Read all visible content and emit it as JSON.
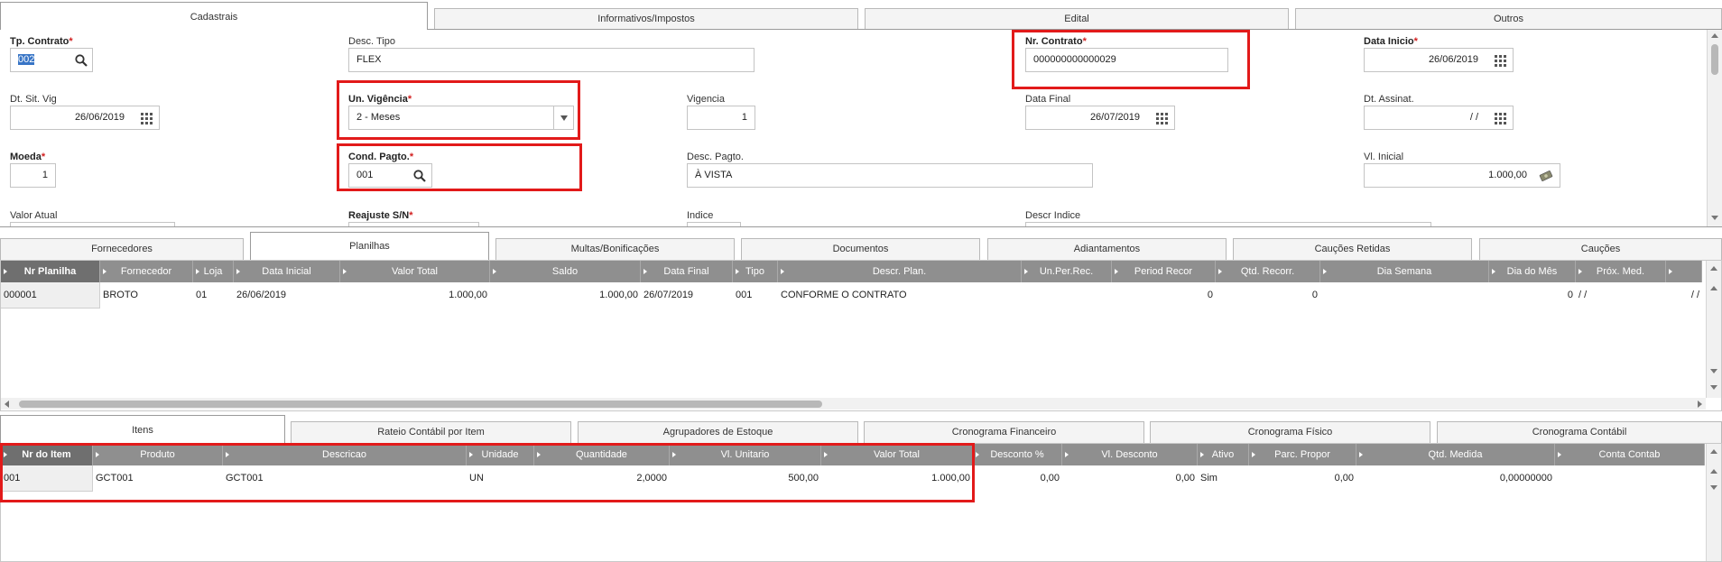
{
  "top_tabs": [
    "Cadastrais",
    "Informativos/Impostos",
    "Edital",
    "Outros"
  ],
  "form": {
    "tp_contrato": {
      "label": "Tp. Contrato",
      "value": "002"
    },
    "desc_tipo": {
      "label": "Desc. Tipo",
      "value": "FLEX"
    },
    "nr_contrato": {
      "label": "Nr. Contrato",
      "value": "000000000000029"
    },
    "data_inicio": {
      "label": "Data Inicio",
      "value": "26/06/2019"
    },
    "dt_sit_vig": {
      "label": "Dt. Sit. Vig",
      "value": "26/06/2019"
    },
    "un_vigencia": {
      "label": "Un. Vigência",
      "value": "2 - Meses"
    },
    "vigencia": {
      "label": "Vigencia",
      "value": "1"
    },
    "data_final": {
      "label": "Data Final",
      "value": "26/07/2019"
    },
    "dt_assinat": {
      "label": "Dt. Assinat.",
      "value": "/  /"
    },
    "moeda": {
      "label": "Moeda",
      "value": "1"
    },
    "cond_pagto": {
      "label": "Cond. Pagto.",
      "value": "001"
    },
    "desc_pagto": {
      "label": "Desc. Pagto.",
      "value": "À VISTA"
    },
    "vl_inicial": {
      "label": "Vl. Inicial",
      "value": "1.000,00"
    },
    "valor_atual": {
      "label": "Valor Atual"
    },
    "reajuste": {
      "label": "Reajuste S/N"
    },
    "indice": {
      "label": "Indice"
    },
    "descr_indice": {
      "label": "Descr Indice"
    },
    "required_mark": "*"
  },
  "middle_tabs": [
    "Fornecedores",
    "Planilhas",
    "Multas/Bonificações",
    "Documentos",
    "Adiantamentos",
    "Cauções Retidas",
    "Cauções"
  ],
  "planilhas": {
    "headers": [
      "Nr Planilha",
      "Fornecedor",
      "Loja",
      "Data Inicial",
      "Valor Total",
      "Saldo",
      "Data Final",
      "Tipo",
      "Descr. Plan.",
      "Un.Per.Rec.",
      "Period Recor",
      "Qtd. Recorr.",
      "Dia Semana",
      "Dia do Mês",
      "Próx. Med.",
      ""
    ],
    "rows": [
      [
        "000001",
        "BROTO",
        "01",
        "26/06/2019",
        "1.000,00",
        "1.000,00",
        "26/07/2019",
        "001",
        "CONFORME O CONTRATO",
        "",
        "0",
        "0",
        "",
        "0",
        "/  /",
        "/  /"
      ]
    ]
  },
  "bottom_tabs": [
    "Itens",
    "Rateio Contábil por Item",
    "Agrupadores de Estoque",
    "Cronograma Financeiro",
    "Cronograma Físico",
    "Cronograma Contábil"
  ],
  "itens": {
    "headers": [
      "Nr do Item",
      "Produto",
      "Descricao",
      "Unidade",
      "Quantidade",
      "Vl. Unitario",
      "Valor Total",
      "Desconto %",
      "Vl. Desconto",
      "Ativo",
      "Parc. Propor",
      "Qtd. Medida",
      "Conta Contab"
    ],
    "rows": [
      [
        "001",
        "GCT001",
        "GCT001",
        "UN",
        "2,0000",
        "500,00",
        "1.000,00",
        "0,00",
        "0,00",
        "Sim",
        "0,00",
        "0,00000000",
        ""
      ]
    ]
  },
  "colors": {
    "highlight": "#e21a1a",
    "header_bg": "#8f8f8f",
    "required": "#d21f1f"
  }
}
